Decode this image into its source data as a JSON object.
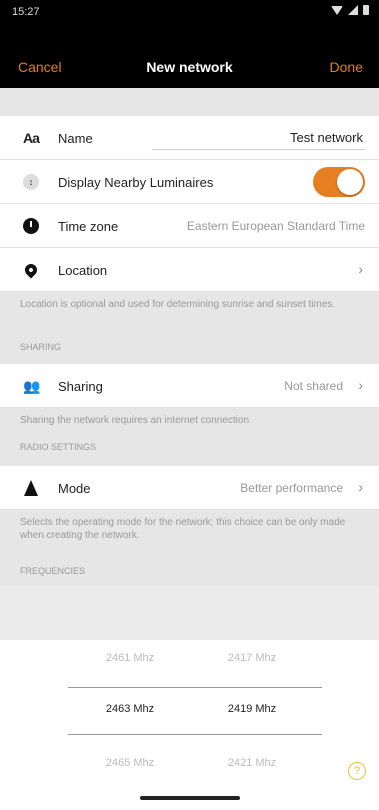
{
  "status_bar": {
    "time": "15:27"
  },
  "nav": {
    "cancel": "Cancel",
    "title": "New network",
    "done": "Done"
  },
  "name_row": {
    "icon_text": "Aa",
    "label": "Name",
    "value": "Test network"
  },
  "nearby_row": {
    "label": "Display Nearby Luminaires",
    "toggle_on": true
  },
  "timezone_row": {
    "label": "Time zone",
    "value": "Eastern European Standard Time"
  },
  "location_row": {
    "label": "Location"
  },
  "location_note": "Location is optional and used for determining sunrise and sunset times.",
  "sharing_header": "SHARING",
  "sharing_row": {
    "label": "Sharing",
    "value": "Not shared"
  },
  "sharing_note": "Sharing the network requires an internet connection",
  "radio_header": "RADIO SETTINGS",
  "mode_row": {
    "label": "Mode",
    "value": "Better performance"
  },
  "mode_note": "Selects the operating mode for the network; this choice can be only made when creating the network.",
  "frequencies_header": "FREQUENCIES",
  "frequencies": {
    "col1": [
      "2461 Mhz",
      "2463 Mhz",
      "2465 Mhz"
    ],
    "col2": [
      "2417 Mhz",
      "2419 Mhz",
      "2421 Mhz"
    ]
  },
  "colors": {
    "accent": "#e67e22",
    "nav_bg": "#000000",
    "help": "#f0c23a"
  }
}
